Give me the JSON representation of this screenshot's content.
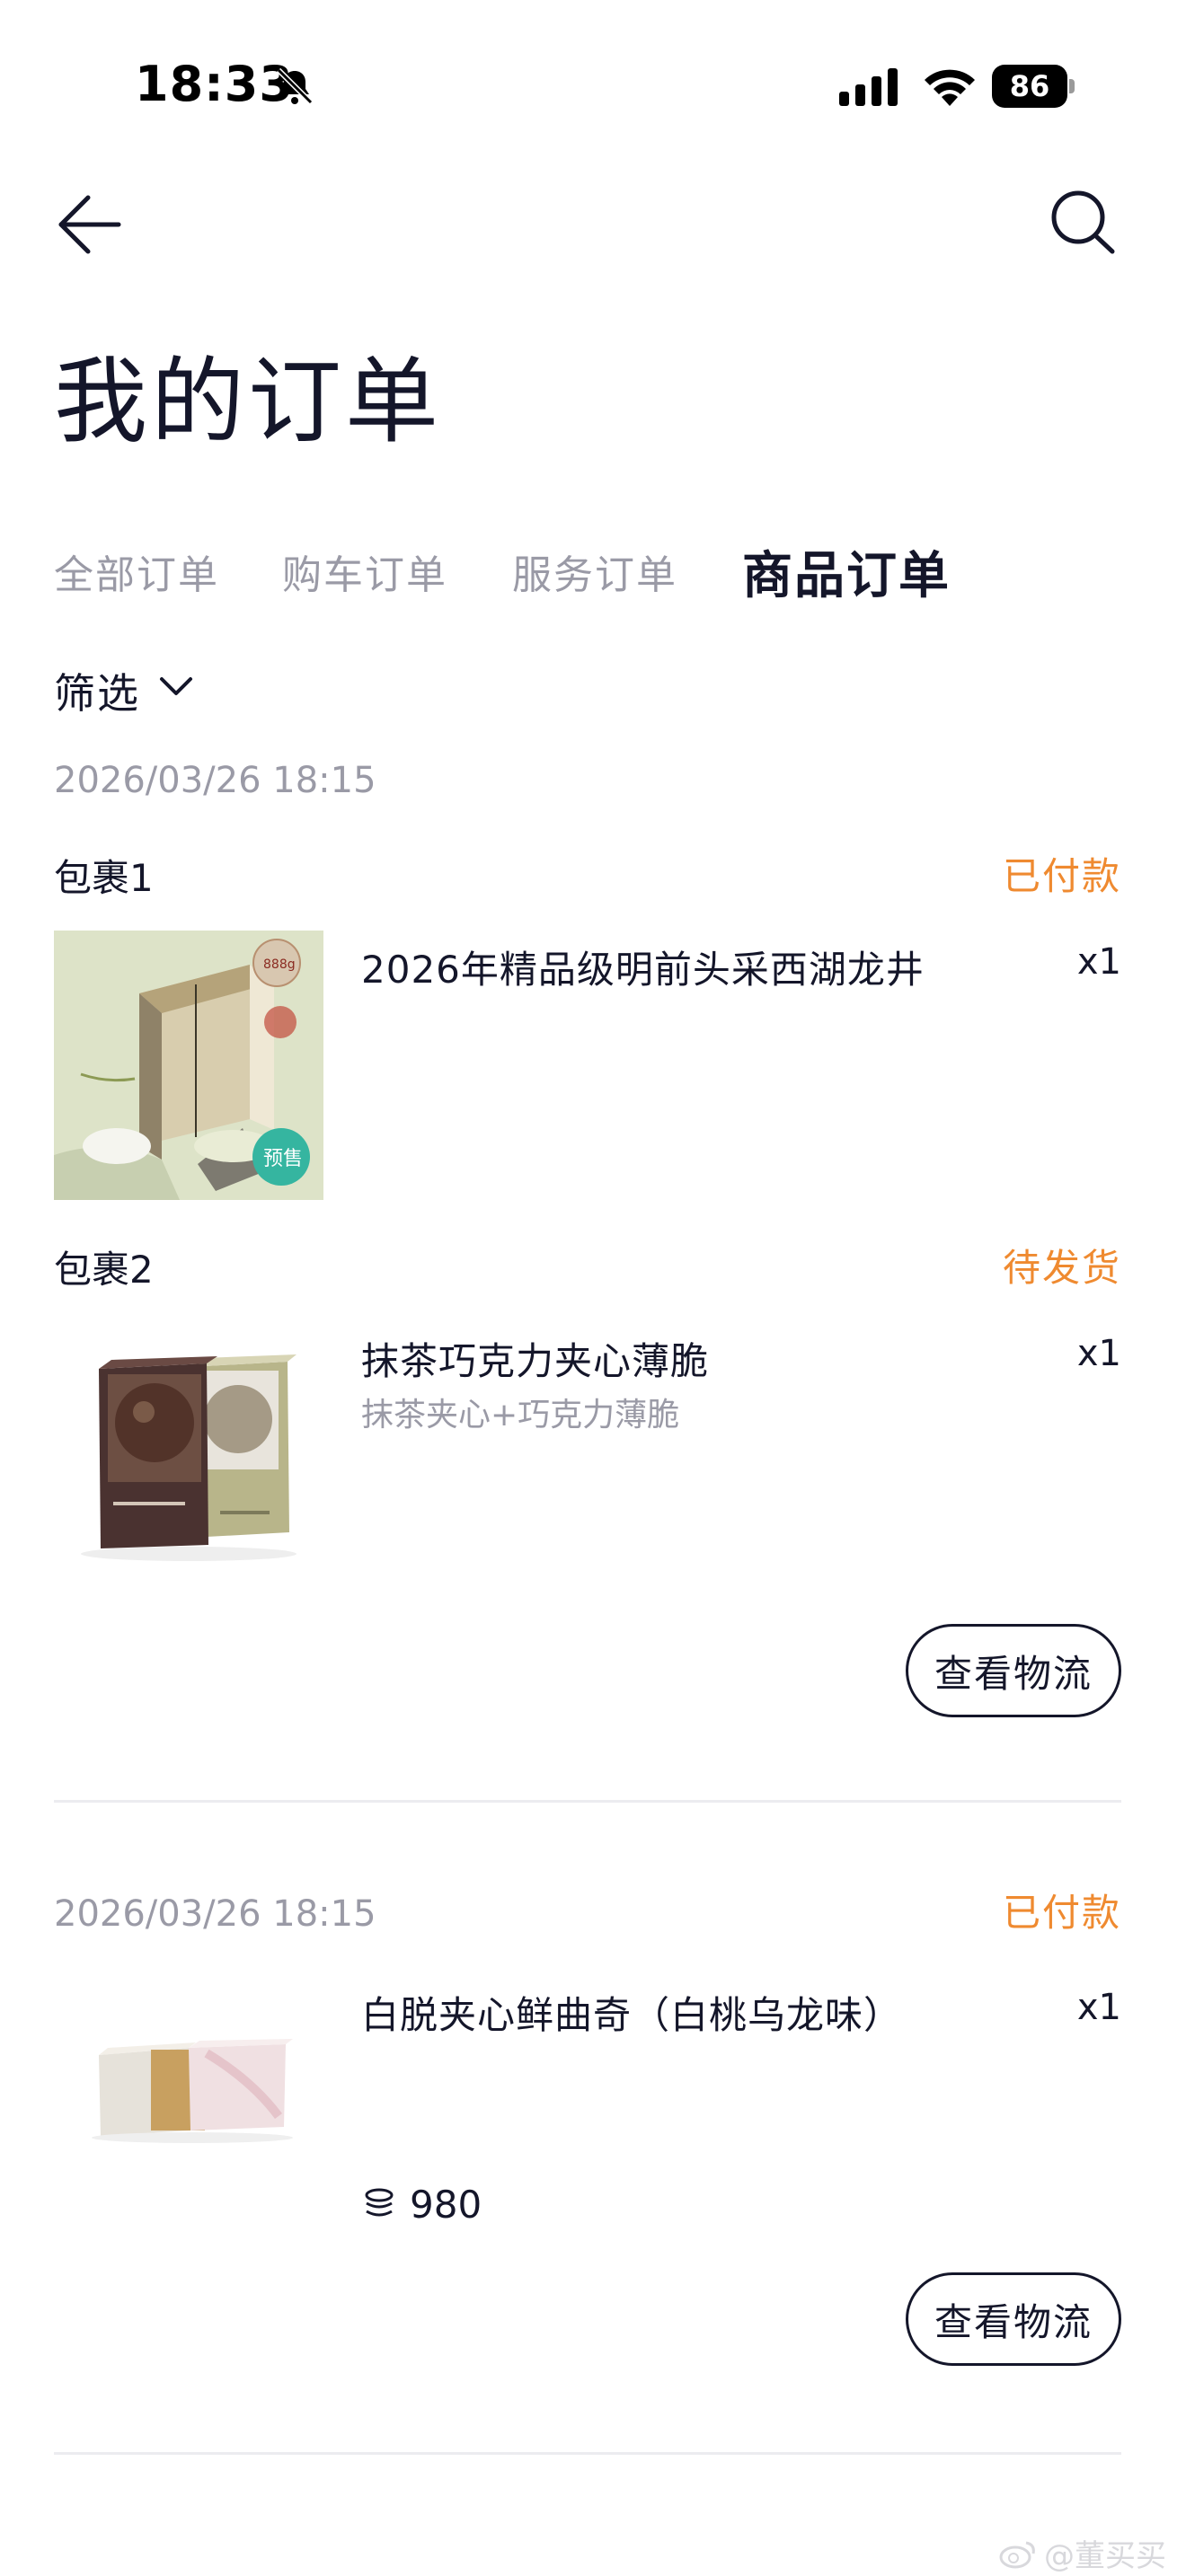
{
  "status_bar": {
    "time": "18:33",
    "battery": "86"
  },
  "header": {
    "title": "我的订单"
  },
  "tabs": [
    {
      "label": "全部订单",
      "active": false
    },
    {
      "label": "购车订单",
      "active": false
    },
    {
      "label": "服务订单",
      "active": false
    },
    {
      "label": "商品订单",
      "active": true
    }
  ],
  "filter": {
    "label": "筛选"
  },
  "orders": [
    {
      "date": "2026/03/26 18:15",
      "packages": [
        {
          "label": "包裹1",
          "status": "已付款",
          "item": {
            "name": "2026年精品级明前头采西湖龙井",
            "qty": "x1",
            "badge": "预售",
            "box_badge": "888g"
          }
        },
        {
          "label": "包裹2",
          "status": "待发货",
          "item": {
            "name": "抹茶巧克力夹心薄脆",
            "variant": "抹茶夹心+巧克力薄脆",
            "qty": "x1"
          }
        }
      ],
      "action": "查看物流"
    },
    {
      "date": "2026/03/26 18:15",
      "status": "已付款",
      "item": {
        "name": "白脱夹心鲜曲奇（白桃乌龙味）",
        "qty": "x1",
        "price": "980"
      },
      "action": "查看物流"
    }
  ],
  "watermark": "@董买买",
  "colors": {
    "accent_orange": "#ef8a30",
    "text_primary": "#14162a",
    "text_secondary": "#9a9aa6"
  }
}
